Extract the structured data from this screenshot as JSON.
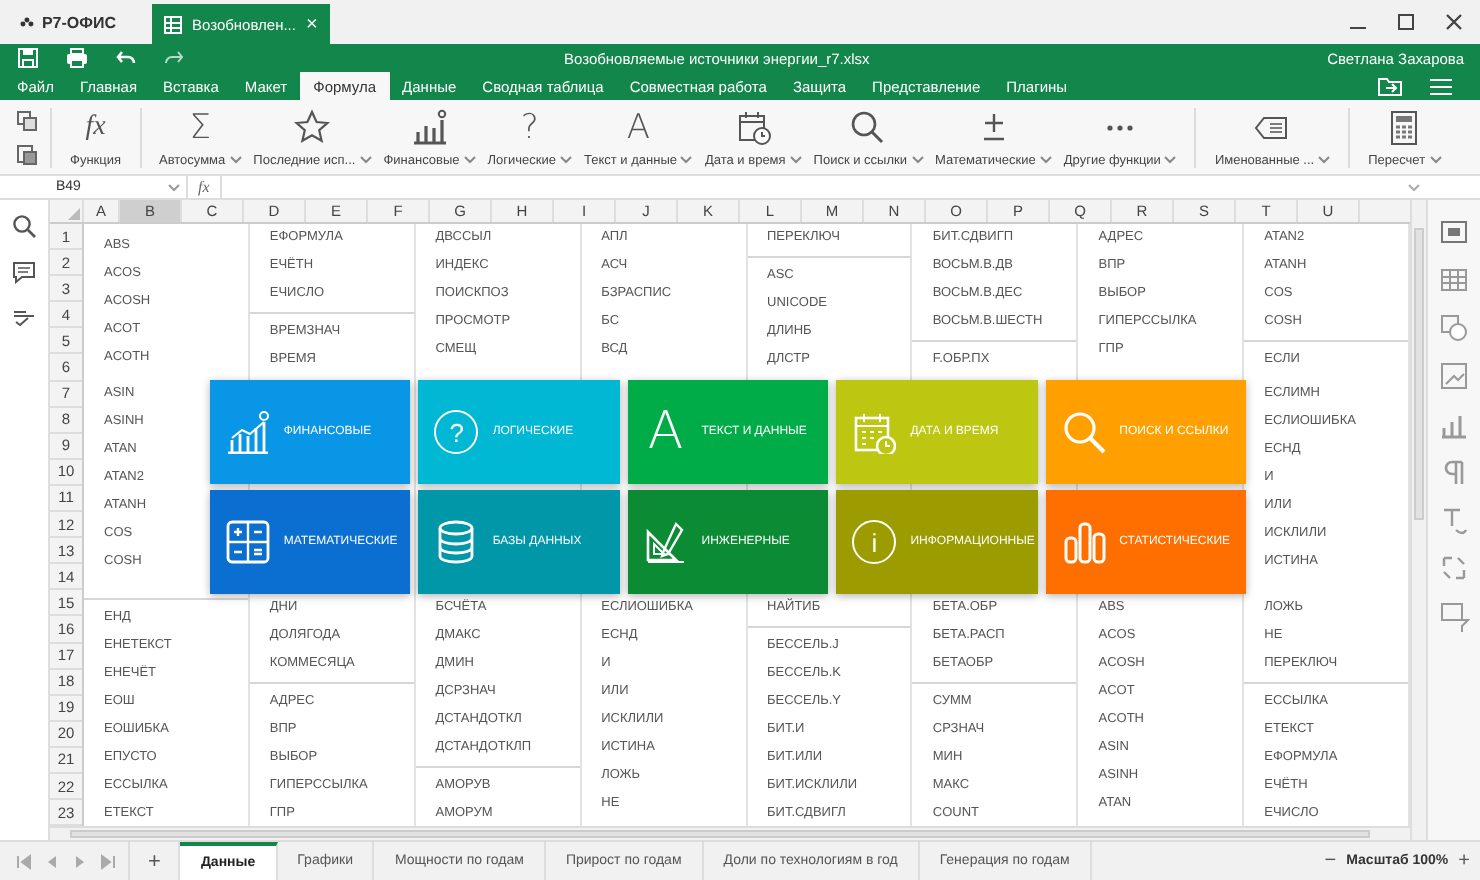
{
  "window": {
    "app_name": "Р7-ОФИС",
    "doc_tab": "Возобновлен...",
    "doc_tab_close": "×",
    "title": "Возобновляемые источники энергии_r7.xlsx",
    "user": "Светлана Захарова"
  },
  "menu_tabs": [
    {
      "label": "Файл",
      "selected": false
    },
    {
      "label": "Главная",
      "selected": false
    },
    {
      "label": "Вставка",
      "selected": false
    },
    {
      "label": "Макет",
      "selected": false
    },
    {
      "label": "Формула",
      "selected": true
    },
    {
      "label": "Данные",
      "selected": false
    },
    {
      "label": "Сводная таблица",
      "selected": false
    },
    {
      "label": "Совместная работа",
      "selected": false
    },
    {
      "label": "Защита",
      "selected": false
    },
    {
      "label": "Представление",
      "selected": false
    },
    {
      "label": "Плагины",
      "selected": false
    }
  ],
  "toolbar": [
    {
      "label": "Функция",
      "glyph": "fx",
      "dropdown": false
    },
    {
      "label": "Автосумма",
      "glyph": "Σ",
      "dropdown": true
    },
    {
      "label": "Последние исп...",
      "dropdown": true
    },
    {
      "label": "Финансовые",
      "dropdown": true
    },
    {
      "label": "Логические",
      "glyph": "?",
      "dropdown": true
    },
    {
      "label": "Текст и данные",
      "glyph": "A",
      "dropdown": true
    },
    {
      "label": "Дата и время",
      "dropdown": true
    },
    {
      "label": "Поиск и ссылки",
      "dropdown": true
    },
    {
      "label": "Математические",
      "dropdown": true
    },
    {
      "label": "Другие функции",
      "dropdown": true
    },
    {
      "label": "Именованные ...",
      "dropdown": true
    },
    {
      "label": "Пересчет",
      "dropdown": true
    }
  ],
  "formula_bar": {
    "cell_name": "B49",
    "fx": "fx"
  },
  "column_headers": [
    {
      "label": "A",
      "selected": false
    },
    {
      "label": "B",
      "selected": true
    },
    {
      "label": "C",
      "selected": false
    },
    {
      "label": "D",
      "selected": false
    },
    {
      "label": "E",
      "selected": false
    },
    {
      "label": "F",
      "selected": false
    },
    {
      "label": "G",
      "selected": false
    },
    {
      "label": "H",
      "selected": false
    },
    {
      "label": "I",
      "selected": false
    },
    {
      "label": "J",
      "selected": false
    },
    {
      "label": "K",
      "selected": false
    },
    {
      "label": "L",
      "selected": false
    },
    {
      "label": "M",
      "selected": false
    },
    {
      "label": "N",
      "selected": false
    },
    {
      "label": "O",
      "selected": false
    },
    {
      "label": "P",
      "selected": false
    },
    {
      "label": "Q",
      "selected": false
    },
    {
      "label": "R",
      "selected": false
    },
    {
      "label": "S",
      "selected": false
    },
    {
      "label": "T",
      "selected": false
    },
    {
      "label": "U",
      "selected": false
    }
  ],
  "row_numbers": [
    "1",
    "2",
    "3",
    "4",
    "5",
    "6",
    "7",
    "8",
    "9",
    "10",
    "11",
    "12",
    "13",
    "14",
    "15",
    "16",
    "17",
    "18",
    "19",
    "20",
    "21",
    "22",
    "23"
  ],
  "columns": [
    {
      "top": [
        {
          "rule": false,
          "items": [
            "ABS",
            "ACOS",
            "ACOSH",
            "ACOT",
            "ACOTH"
          ]
        }
      ],
      "middle": [
        {
          "rule": false,
          "items": [
            "ASIN",
            "ASINH",
            "ATAN",
            "ATAN2",
            "ATANH",
            "COS",
            "COSH"
          ]
        }
      ],
      "bottom": [
        {
          "rule": true,
          "items": [
            "ЕНД",
            "ЕНЕТЕКСТ",
            "ЕНЕЧЁТ",
            "ЕОШ",
            "ЕОШИБКА",
            "ЕПУСТО",
            "ЕССЫЛКА",
            "ЕТЕКСТ"
          ]
        }
      ]
    },
    {
      "top": [
        {
          "rule": false,
          "items": [
            "ЕФОРМУЛА",
            "ЕЧЁТН",
            "ЕЧИСЛО"
          ]
        },
        {
          "rule": true,
          "items": [
            "ВРЕМЗНАЧ",
            "ВРЕМЯ"
          ]
        }
      ],
      "bottom": [
        {
          "rule": false,
          "items": [
            "ДНИ",
            "ДОЛЯГОДА",
            "КОММЕСЯЦА"
          ]
        },
        {
          "rule": true,
          "items": [
            "АДРЕС",
            "ВПР",
            "ВЫБОР",
            "ГИПЕРССЫЛКА",
            "ГПР"
          ]
        }
      ]
    },
    {
      "top": [
        {
          "rule": false,
          "items": [
            "ДВССЫЛ",
            "ИНДЕКС",
            "ПОИСКПОЗ",
            "ПРОСМОТР",
            "СМЕЩ"
          ]
        }
      ],
      "bottom": [
        {
          "rule": false,
          "items": [
            "БСЧЁТА",
            "ДМАКС",
            "ДМИН",
            "ДСРЗНАЧ",
            "ДСТАНДОТКЛ",
            "ДСТАНДОТКЛП"
          ]
        },
        {
          "rule": true,
          "items": [
            "АМОРУВ",
            "АМОРУМ"
          ]
        }
      ]
    },
    {
      "top": [
        {
          "rule": false,
          "items": [
            "АПЛ",
            "АСЧ",
            "БЗРАСПИС",
            "БС",
            "ВСД"
          ]
        }
      ],
      "bottom": [
        {
          "rule": false,
          "items": [
            "ЕСЛИОШИБКА",
            "ЕСНД",
            "И",
            "ИЛИ",
            "ИСКЛИЛИ",
            "ИСТИНА",
            "ЛОЖЬ",
            "НЕ"
          ]
        }
      ]
    },
    {
      "top": [
        {
          "rule": false,
          "items": [
            "ПЕРЕКЛЮЧ"
          ]
        },
        {
          "rule": true,
          "items": [
            "ASC",
            "UNICODE",
            "ДЛИНБ",
            "ДЛСТР"
          ]
        }
      ],
      "bottom": [
        {
          "rule": false,
          "items": [
            "НАЙТИБ"
          ]
        },
        {
          "rule": true,
          "items": [
            "БЕССЕЛЬ.J",
            "БЕССЕЛЬ.K",
            "БЕССЕЛЬ.Y",
            "БИТ.И",
            "БИТ.ИЛИ",
            "БИТ.ИСКЛИЛИ",
            "БИТ.СДВИГЛ"
          ]
        }
      ]
    },
    {
      "top": [
        {
          "rule": false,
          "items": [
            "БИТ.СДВИГП",
            "ВОСЬМ.В.ДВ",
            "ВОСЬМ.В.ДЕС",
            "ВОСЬМ.В.ШЕСТН"
          ]
        },
        {
          "rule": true,
          "items": [
            "F.ОБР.ПХ"
          ]
        }
      ],
      "bottom": [
        {
          "rule": false,
          "items": [
            "БЕТА.ОБР",
            "БЕТА.РАСП",
            "БЕТАОБР"
          ]
        },
        {
          "rule": true,
          "items": [
            "СУММ",
            "СРЗНАЧ",
            "МИН",
            "МАКС",
            "COUNT"
          ]
        }
      ]
    },
    {
      "top": [
        {
          "rule": false,
          "items": [
            "АДРЕС",
            "ВПР",
            "ВЫБОР",
            "ГИПЕРССЫЛКА",
            "ГПР"
          ]
        }
      ],
      "bottom": [
        {
          "rule": false,
          "items": [
            "ABS",
            "ACOS",
            "ACOSH",
            "ACOT",
            "ACOTH",
            "ASIN",
            "ASINH",
            "ATAN"
          ]
        }
      ]
    },
    {
      "top": [
        {
          "rule": false,
          "items": [
            "ATAN2",
            "ATANH",
            "COS",
            "COSH"
          ]
        },
        {
          "rule": true,
          "items": [
            "ЕСЛИ"
          ]
        }
      ],
      "middle": [
        {
          "rule": false,
          "items": [
            "ЕСЛИМН",
            "ЕСЛИОШИБКА",
            "ЕСНД",
            "И",
            "ИЛИ",
            "ИСКЛИЛИ",
            "ИСТИНА"
          ]
        }
      ],
      "bottom": [
        {
          "rule": false,
          "items": [
            "ЛОЖЬ",
            "НЕ",
            "ПЕРЕКЛЮЧ"
          ]
        },
        {
          "rule": true,
          "items": [
            "ЕССЫЛКА",
            "ЕТЕКСТ",
            "ЕФОРМУЛА",
            "ЕЧЁТН",
            "ЕЧИСЛО"
          ]
        }
      ]
    }
  ],
  "tiles": [
    {
      "label": "ФИНАНСОВЫЕ",
      "color": "#0a96e6"
    },
    {
      "label": "ЛОГИЧЕСКИЕ",
      "color": "#00b8d4",
      "glyph": "?"
    },
    {
      "label": "ТЕКСТ И ДАННЫЕ",
      "color": "#00ac47",
      "glyph": "A"
    },
    {
      "label": "ДАТА И ВРЕМЯ",
      "color": "#bdc712"
    },
    {
      "label": "ПОИСК И ССЫЛКИ",
      "color": "#ffa000"
    },
    {
      "label": "МАТЕМАТИЧЕСКИЕ",
      "color": "#0a6fd0"
    },
    {
      "label": "БАЗЫ ДАННЫХ",
      "color": "#0097a9"
    },
    {
      "label": "ИНЖЕНЕРНЫЕ",
      "color": "#0a8b34"
    },
    {
      "label": "ИНФОРМАЦИОННЫЕ",
      "color": "#9c9c00",
      "glyph": "i"
    },
    {
      "label": "СТАТИСТИЧЕСКИЕ",
      "color": "#ff6f00"
    }
  ],
  "add_sheet": "+",
  "sheet_tabs": [
    {
      "label": "Данные",
      "selected": true
    },
    {
      "label": "Графики",
      "selected": false
    },
    {
      "label": "Мощности по годам",
      "selected": false
    },
    {
      "label": "Прирост по годам",
      "selected": false
    },
    {
      "label": "Доли по технологиям в год",
      "selected": false
    },
    {
      "label": "Генерация по годам",
      "selected": false
    }
  ],
  "zoom": {
    "minus": "−",
    "label": "Масштаб 100%",
    "plus": "+"
  }
}
